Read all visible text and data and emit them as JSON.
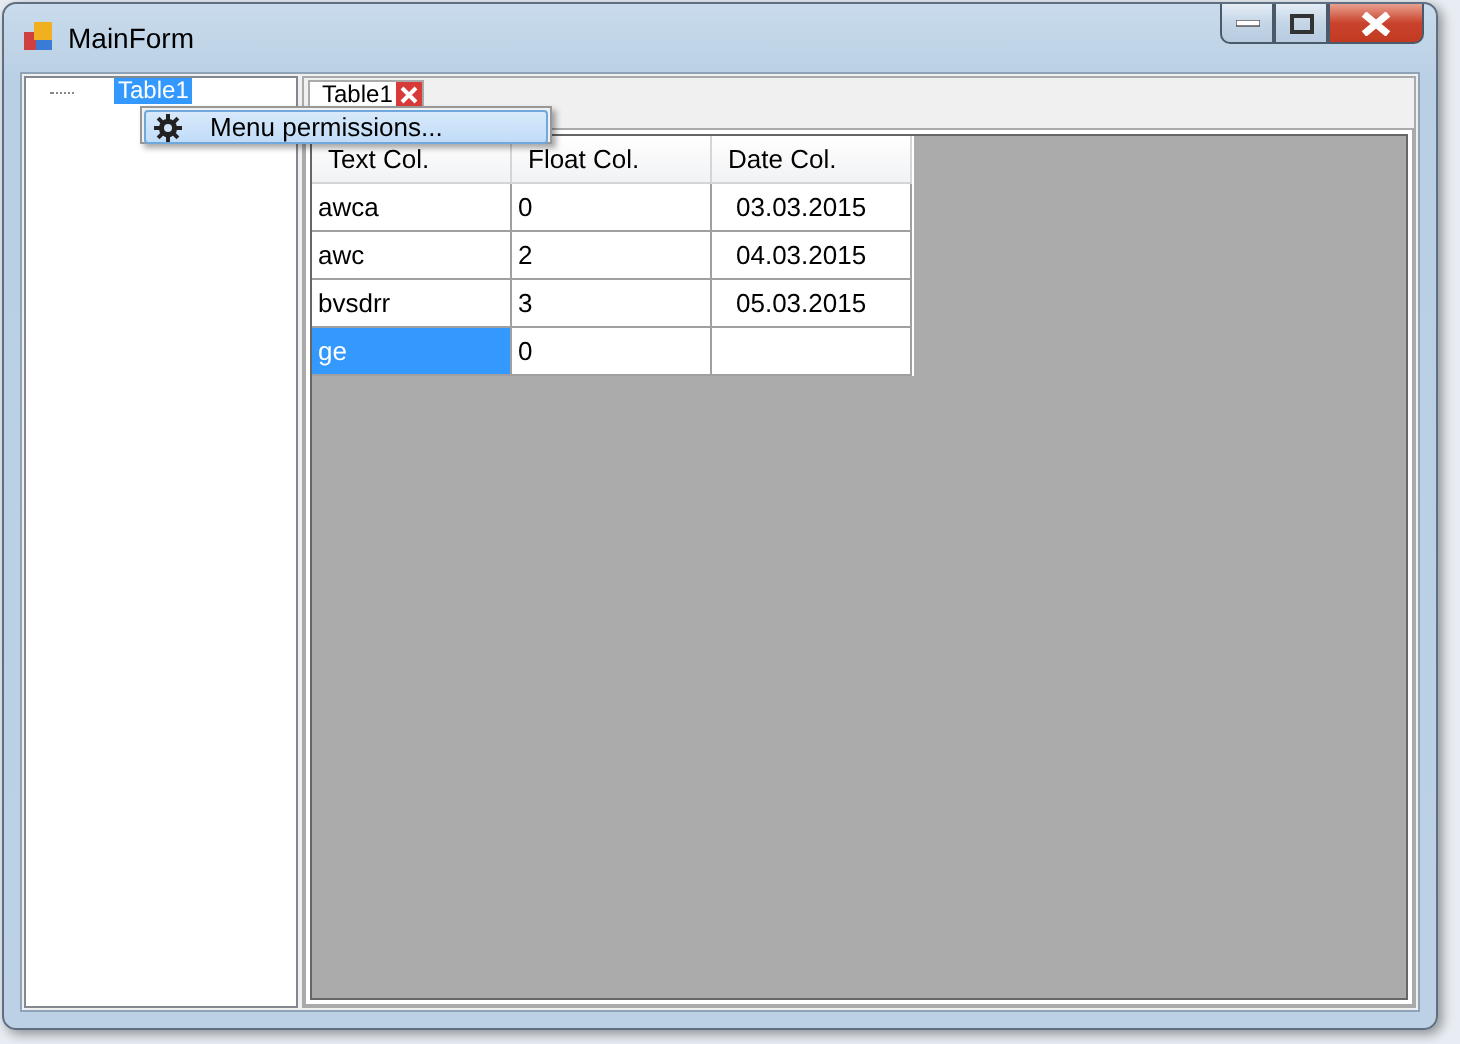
{
  "window": {
    "title": "MainForm"
  },
  "tree": {
    "items": [
      {
        "label": "Table1",
        "selected": true
      }
    ]
  },
  "context_menu": {
    "items": [
      {
        "label": "Menu permissions..."
      }
    ]
  },
  "tabs": [
    {
      "label": "Table1",
      "selected": true
    }
  ],
  "table": {
    "columns": [
      "Text Col.",
      "Float Col.",
      "Date Col."
    ],
    "rows": [
      {
        "cells": [
          {
            "text": "awca",
            "selected": false
          },
          {
            "text": "0",
            "selected": false
          },
          {
            "text": "03.03.2015",
            "selected": false
          }
        ]
      },
      {
        "cells": [
          {
            "text": "awc",
            "selected": false
          },
          {
            "text": "2",
            "selected": false
          },
          {
            "text": "04.03.2015",
            "selected": false
          }
        ]
      },
      {
        "cells": [
          {
            "text": "bvsdrr",
            "selected": false
          },
          {
            "text": "3",
            "selected": false
          },
          {
            "text": "05.03.2015",
            "selected": false
          }
        ]
      },
      {
        "cells": [
          {
            "text": "ge",
            "selected": true
          },
          {
            "text": "0",
            "selected": false
          },
          {
            "text": "",
            "selected": false
          }
        ]
      }
    ]
  }
}
